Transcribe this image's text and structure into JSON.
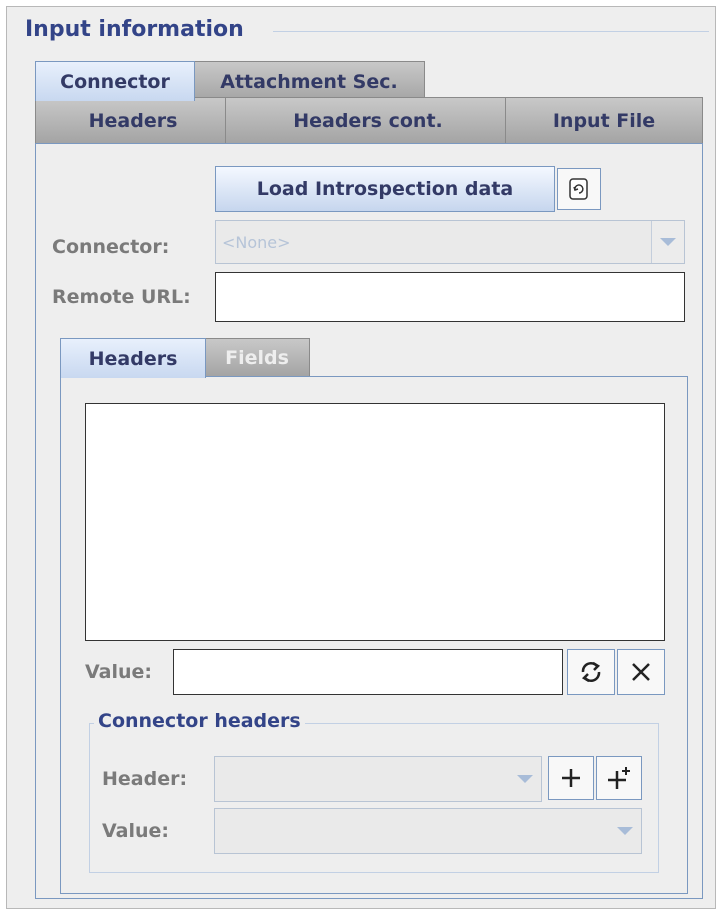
{
  "panel": {
    "title": "Input information"
  },
  "tabs": {
    "row1": [
      {
        "label": "Connector",
        "active": true
      },
      {
        "label": "Attachment Sec.",
        "active": false
      }
    ],
    "row2": [
      {
        "label": "Headers"
      },
      {
        "label": "Headers cont."
      },
      {
        "label": "Input File"
      }
    ]
  },
  "connector_tab": {
    "load_button_label": "Load Introspection data",
    "connector_label": "Connector:",
    "connector_value": "<None>",
    "remote_url_label": "Remote URL:",
    "remote_url_value": ""
  },
  "inner_tabs": [
    {
      "label": "Headers",
      "active": true
    },
    {
      "label": "Fields",
      "active": false
    }
  ],
  "headers_panel": {
    "list_items": [],
    "value_label": "Value:",
    "value_value": ""
  },
  "connector_headers": {
    "title": "Connector headers",
    "header_label": "Header:",
    "header_value": "",
    "value_label": "Value:",
    "value_value": ""
  },
  "colors": {
    "title": "#334488",
    "disabled_text": "#7a7a7a",
    "tab_active": "#c8d8f0",
    "tab_inactive": "#a4a4a4"
  }
}
